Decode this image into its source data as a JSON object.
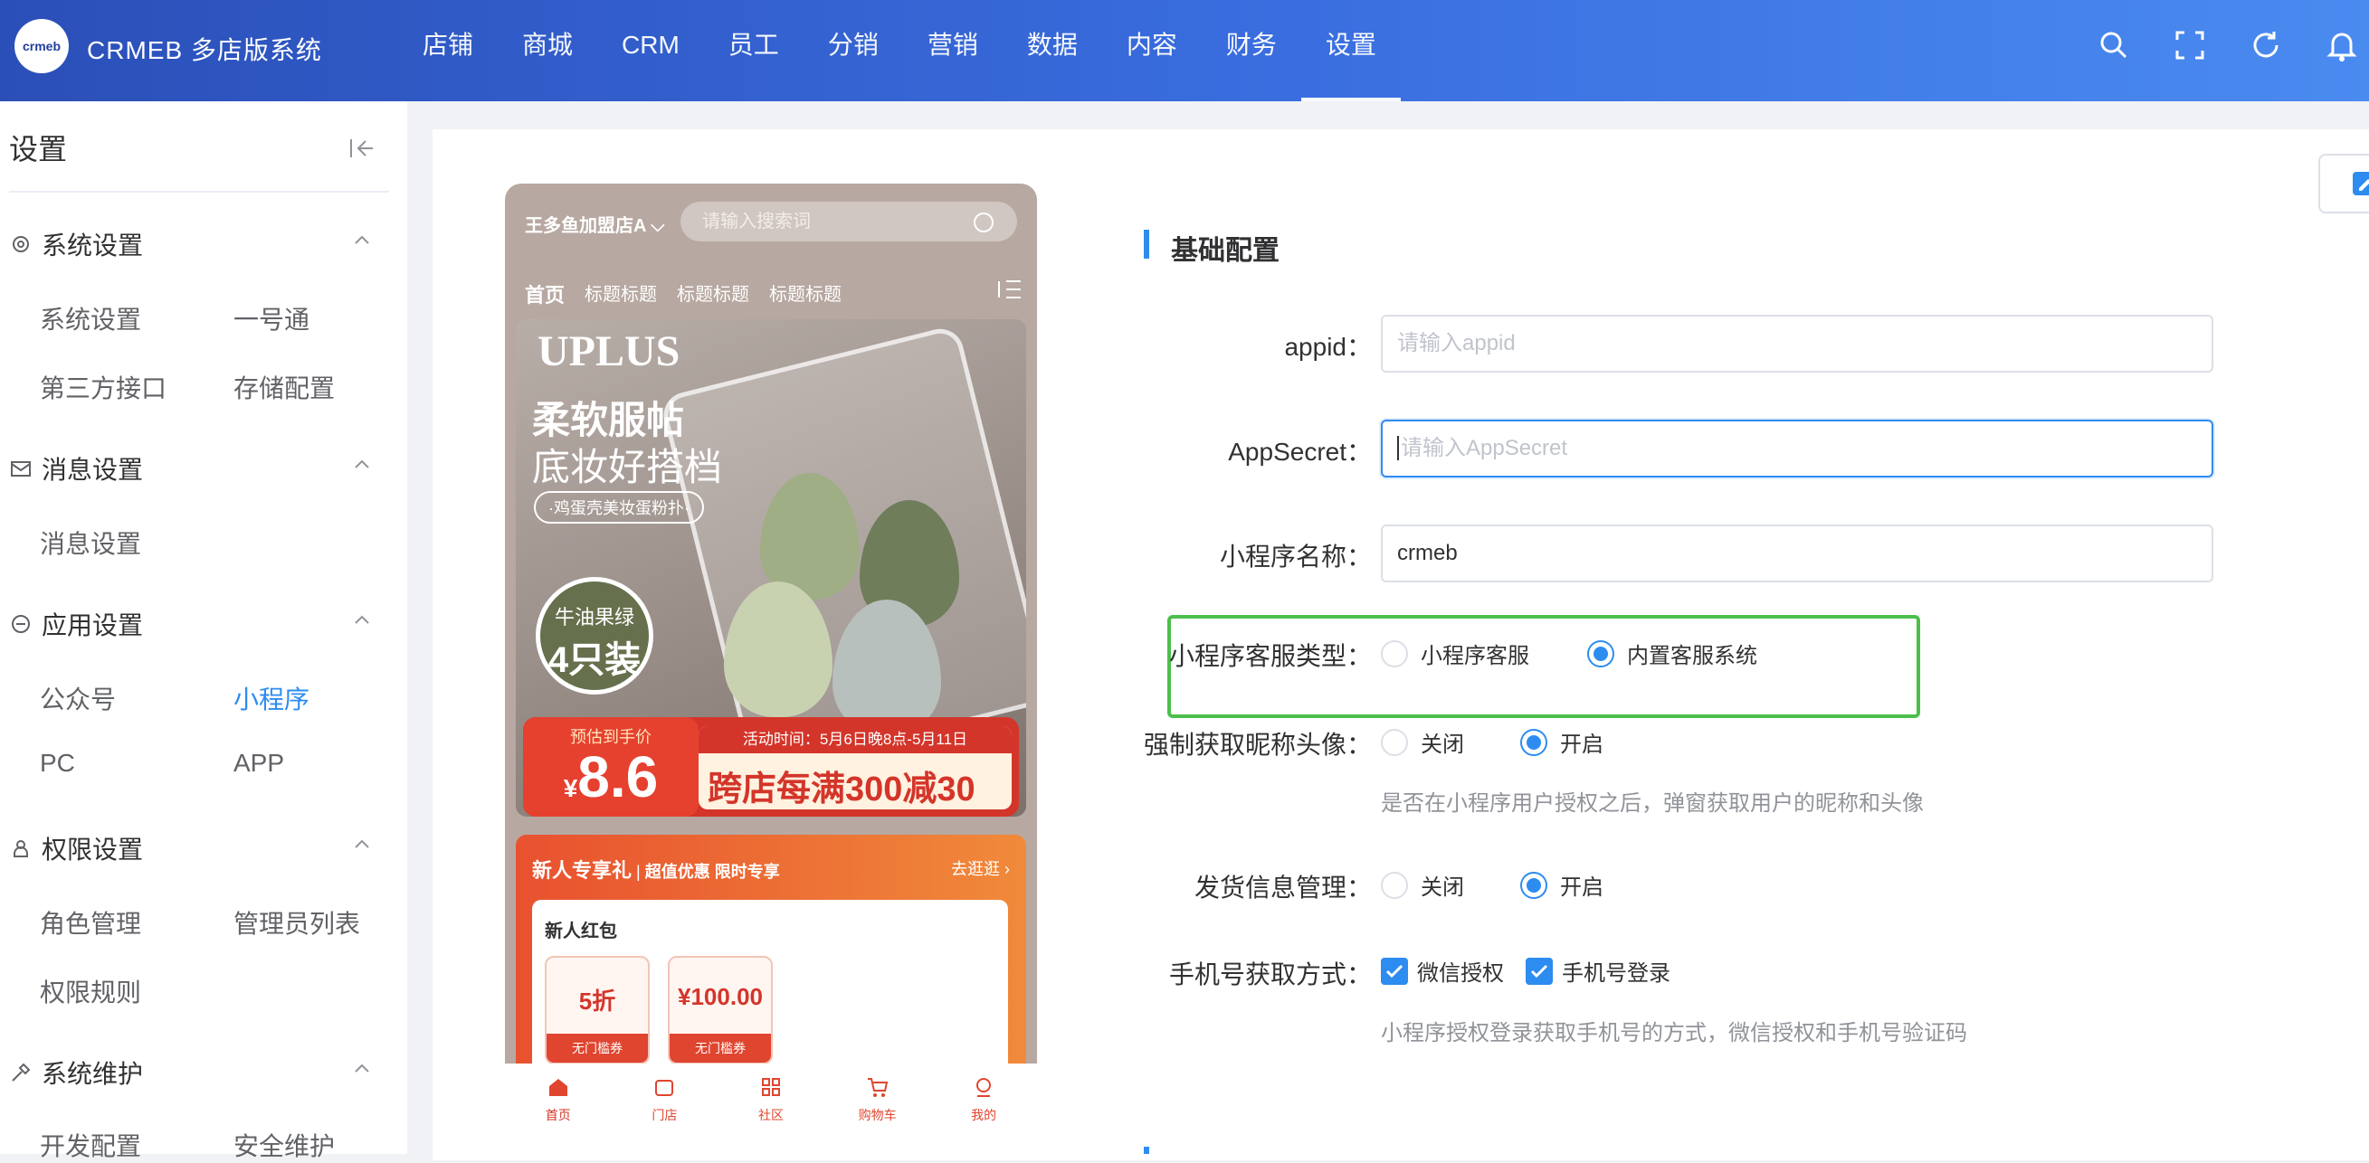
{
  "app": {
    "logo_text": "crmeb",
    "brand": "CRMEB 多店版系统"
  },
  "nav": [
    "店铺",
    "商城",
    "CRM",
    "员工",
    "分销",
    "营销",
    "数据",
    "内容",
    "财务",
    "设置"
  ],
  "nav_active": "设置",
  "sidebar": {
    "title": "设置",
    "groups": [
      {
        "label": "系统设置",
        "items": [
          "系统设置",
          "一号通",
          "第三方接口",
          "存储配置"
        ]
      },
      {
        "label": "消息设置",
        "items": [
          "消息设置"
        ]
      },
      {
        "label": "应用设置",
        "items": [
          "公众号",
          "小程序",
          "PC",
          "APP"
        ]
      },
      {
        "label": "权限设置",
        "items": [
          "角色管理",
          "管理员列表",
          "权限规则"
        ]
      },
      {
        "label": "系统维护",
        "items": [
          "开发配置",
          "安全维护"
        ]
      }
    ],
    "active_item": "小程序"
  },
  "phone": {
    "shop": "王多鱼加盟店A",
    "search_placeholder": "请输入搜索词",
    "tabs": [
      "首页",
      "标题标题",
      "标题标题",
      "标题标题"
    ],
    "banner": {
      "logo": "UPLUS",
      "headline1": "柔软服帖",
      "headline2": "底妆好搭档",
      "tag": "·鸡蛋壳美妆蛋粉扑·",
      "circle1": "牛油果绿",
      "circle2": "4只装",
      "price_label": "预估到手价",
      "price_currency": "¥",
      "price": "8.6",
      "activity_time": "活动时间：5月6日晚8点-5月11日",
      "promo": "跨店每满300减30"
    },
    "newuser": {
      "title": "新人专享礼",
      "subtitle": "超值优惠 限时专享",
      "more": "去逛逛",
      "card_title": "新人红包",
      "coupons": [
        {
          "value": "5折",
          "tag": "无门槛券"
        },
        {
          "value": "¥100.00",
          "tag": "无门槛券"
        }
      ]
    },
    "tabbar": [
      "首页",
      "门店",
      "社区",
      "购物车",
      "我的"
    ]
  },
  "form": {
    "section_title": "基础配置",
    "appid": {
      "label": "appid：",
      "placeholder": "请输入appid",
      "value": ""
    },
    "appsecret": {
      "label": "AppSecret：",
      "placeholder": "请输入AppSecret",
      "value": ""
    },
    "mini_name": {
      "label": "小程序名称：",
      "value": "crmeb"
    },
    "service_type": {
      "label": "小程序客服类型：",
      "options": [
        "小程序客服",
        "内置客服系统"
      ],
      "selected": "内置客服系统"
    },
    "force_avatar": {
      "label": "强制获取昵称头像：",
      "options": [
        "关闭",
        "开启"
      ],
      "selected": "开启",
      "hint": "是否在小程序用户授权之后，弹窗获取用户的昵称和头像"
    },
    "shipping": {
      "label": "发货信息管理：",
      "options": [
        "关闭",
        "开启"
      ],
      "selected": "开启"
    },
    "phone_method": {
      "label": "手机号获取方式：",
      "options": [
        "微信授权",
        "手机号登录"
      ],
      "checked": [
        "微信授权",
        "手机号登录"
      ],
      "hint": "小程序授权登录获取手机号的方式，微信授权和手机号验证码"
    }
  },
  "colors": {
    "primary": "#2d8cf0",
    "topbar": "#3a6ee0",
    "highlight": "#4cbf4c"
  }
}
